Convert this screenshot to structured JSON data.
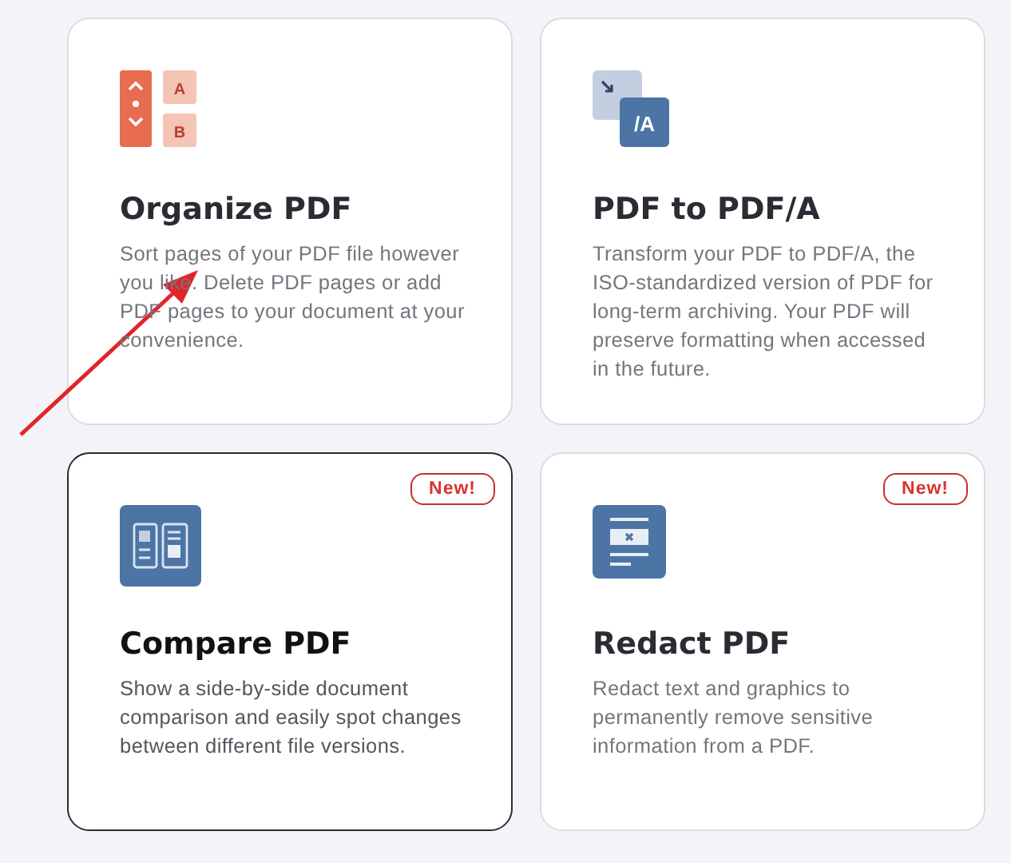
{
  "tools": [
    {
      "icon": {
        "kind": "organize",
        "letters": [
          "A",
          "B"
        ]
      },
      "title": "Organize PDF",
      "description": "Sort pages of your PDF file however you like. Delete PDF pages or add PDF pages to your document at your convenience.",
      "hovered": false
    },
    {
      "icon": {
        "kind": "convert",
        "letters": [
          "/A"
        ]
      },
      "title": "PDF to PDF/A",
      "description": "Transform your PDF to PDF/A, the ISO-standardized version of PDF for long-term archiving. Your PDF will preserve formatting when accessed in the future.",
      "hovered": false
    },
    {
      "icon": {
        "kind": "compare"
      },
      "title": "Compare PDF",
      "description": "Show a side-by-side document comparison and easily spot changes between different file versions.",
      "badge": "New!",
      "hovered": true
    },
    {
      "icon": {
        "kind": "redact"
      },
      "title": "Redact PDF",
      "description": "Redact text and graphics to permanently remove sensitive information from a PDF.",
      "badge": "New!",
      "hovered": false
    }
  ]
}
